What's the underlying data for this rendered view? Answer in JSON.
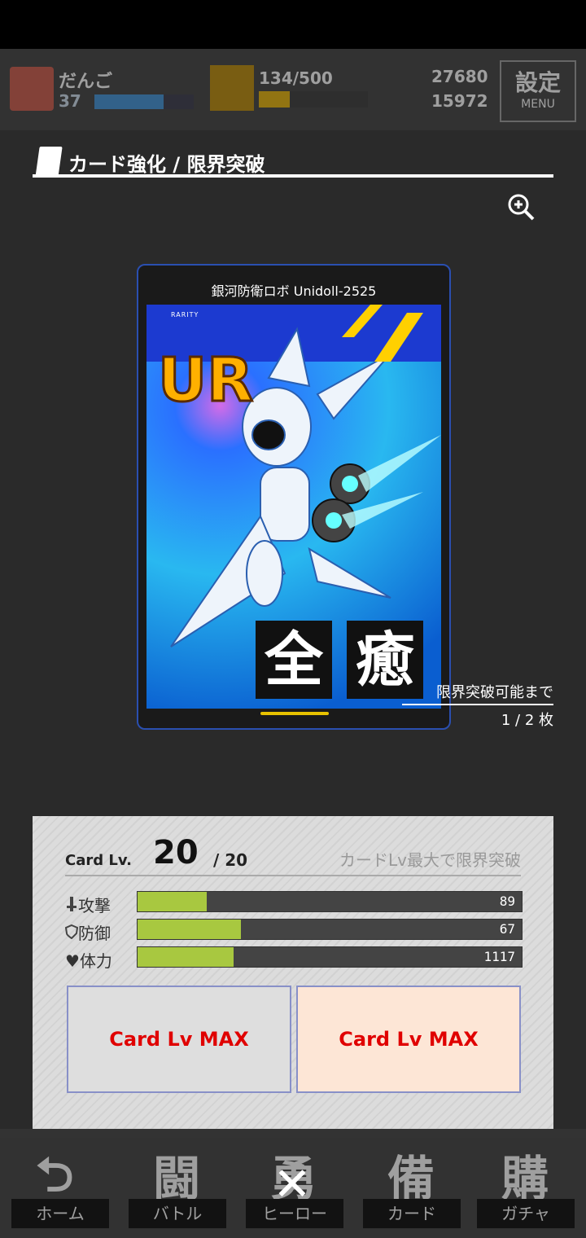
{
  "hud": {
    "player_name": "だんご",
    "player_level": "37",
    "stamina": "134/500",
    "coins": "27680",
    "gems": "15972",
    "menu_main": "設定",
    "menu_sub": "MENU"
  },
  "header": {
    "title": "カード強化 / 限界突破"
  },
  "card": {
    "name": "銀河防衛ロボ Unidoll-2525",
    "rarity": "UR",
    "rarity_caption": "RARITY",
    "kanji_1": "全",
    "kanji_2": "癒"
  },
  "limit_break": {
    "label": "限界突破可能まで",
    "count": "1 / 2 枚"
  },
  "panel": {
    "lv_label": "Card Lv.",
    "lv_current": "20",
    "lv_max": "/ 20",
    "lv_note": "カードLv最大で限界突破",
    "stats": [
      {
        "label": "攻撃",
        "value": "89",
        "fill": 0.18
      },
      {
        "label": "防御",
        "value": "67",
        "fill": 0.27
      },
      {
        "label": "体力",
        "value": "1117",
        "fill": 0.25
      }
    ],
    "button_left": "Card Lv MAX",
    "button_right": "Card Lv MAX"
  },
  "nav": {
    "tabs": [
      {
        "label": "ホーム",
        "glyph": ""
      },
      {
        "label": "バトル",
        "glyph": "闘"
      },
      {
        "label": "ヒーロー",
        "glyph": "勇"
      },
      {
        "label": "カード",
        "glyph": "備"
      },
      {
        "label": "ガチャ",
        "glyph": "購"
      }
    ],
    "close": "✕"
  }
}
